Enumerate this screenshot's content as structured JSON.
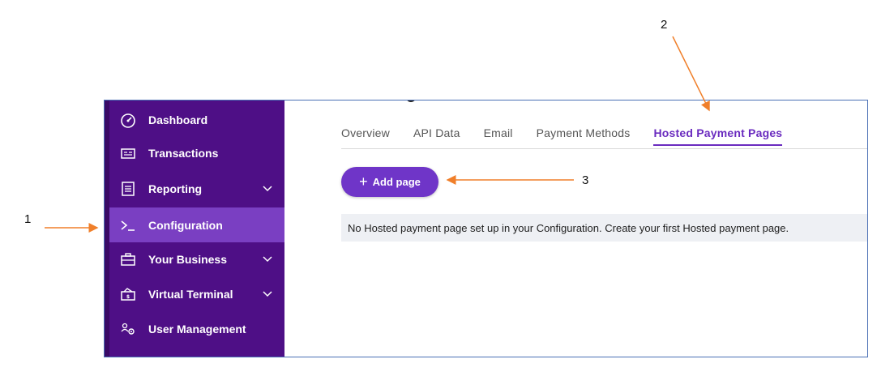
{
  "sidebar": {
    "items": [
      {
        "label": "Dashboard",
        "icon": "speedometer-icon",
        "has_chevron": false
      },
      {
        "label": "Transactions",
        "icon": "receipt-icon",
        "has_chevron": false
      },
      {
        "label": "Reporting",
        "icon": "document-icon",
        "has_chevron": true
      },
      {
        "label": "Configuration",
        "icon": "terminal-icon",
        "has_chevron": false,
        "active": true
      },
      {
        "label": "Your Business",
        "icon": "briefcase-icon",
        "has_chevron": true
      },
      {
        "label": "Virtual Terminal",
        "icon": "card-reader-icon",
        "has_chevron": true
      },
      {
        "label": "User Management",
        "icon": "users-gear-icon",
        "has_chevron": false
      }
    ]
  },
  "tabs": [
    {
      "label": "Overview"
    },
    {
      "label": "API Data"
    },
    {
      "label": "Email"
    },
    {
      "label": "Payment Methods"
    },
    {
      "label": "Hosted Payment Pages",
      "active": true
    }
  ],
  "add_button": {
    "label": "Add page"
  },
  "empty_message": "No Hosted payment page set up in your Configuration. Create your first Hosted payment page.",
  "callouts": {
    "one": "1",
    "two": "2",
    "three": "3"
  },
  "colors": {
    "sidebar": "#4e0f86",
    "active_item": "#7a3fc2",
    "accent": "#6f35c8",
    "arrow": "#f07f2a"
  }
}
